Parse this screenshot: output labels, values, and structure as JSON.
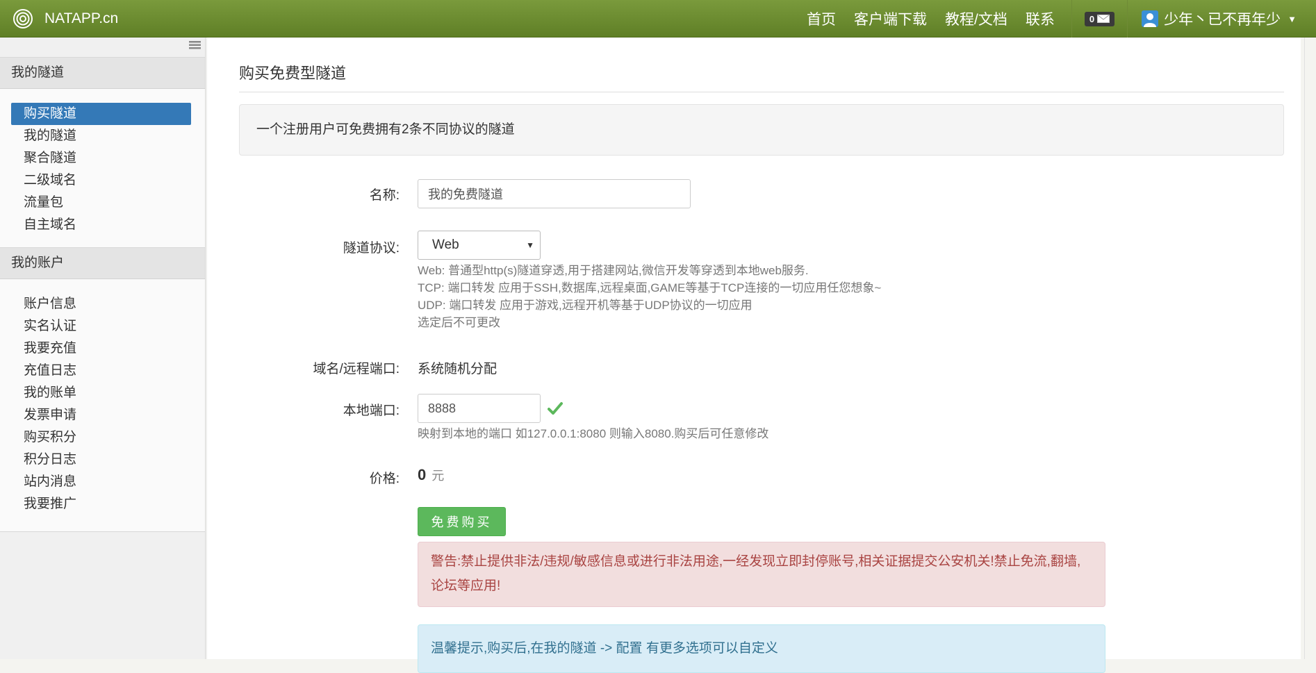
{
  "navbar": {
    "brand": "NATAPP.cn",
    "links": [
      "首页",
      "客户端下载",
      "教程/文档",
      "联系"
    ],
    "message_count": "0",
    "username": "少年丶已不再年少",
    "accent": "#6b8c2f"
  },
  "sidebar": {
    "group1": {
      "title": "我的隧道",
      "items": [
        "购买隧道",
        "我的隧道",
        "聚合隧道",
        "二级域名",
        "流量包",
        "自主域名"
      ]
    },
    "group2": {
      "title": "我的账户",
      "items": [
        "账户信息",
        "实名认证",
        "我要充值",
        "充值日志",
        "我的账单",
        "发票申请",
        "购买积分",
        "积分日志",
        "站内消息",
        "我要推广"
      ]
    }
  },
  "main": {
    "title": "购买免费型隧道",
    "info": "一个注册用户可免费拥有2条不同协议的隧道",
    "name_label": "名称:",
    "name_value": "我的免费隧道",
    "protocol_label": "隧道协议:",
    "protocol_value": "Web",
    "protocol_help": [
      "Web: 普通型http(s)隧道穿透,用于搭建网站,微信开发等穿透到本地web服务.",
      "TCP: 端口转发 应用于SSH,数据库,远程桌面,GAME等基于TCP连接的一切应用任您想象~",
      "UDP: 端口转发 应用于游戏,远程开机等基于UDP协议的一切应用",
      "选定后不可更改"
    ],
    "domain_label": "域名/远程端口:",
    "domain_value": "系统随机分配",
    "port_label": "本地端口:",
    "port_value": "8888",
    "port_help": "映射到本地的端口 如127.0.0.1:8080 则输入8080.购买后可任意修改",
    "price_label": "价格:",
    "price_value": "0",
    "price_unit": "元",
    "buy_button": "免费购买",
    "warning": "警告:禁止提供非法/违规/敏感信息或进行非法用途,一经发现立即封停账号,相关证据提交公安机关!禁止免流,翻墙,论坛等应用!",
    "tip": "温馨提示,购买后,在我的隧道 -> 配置 有更多选项可以自定义"
  }
}
